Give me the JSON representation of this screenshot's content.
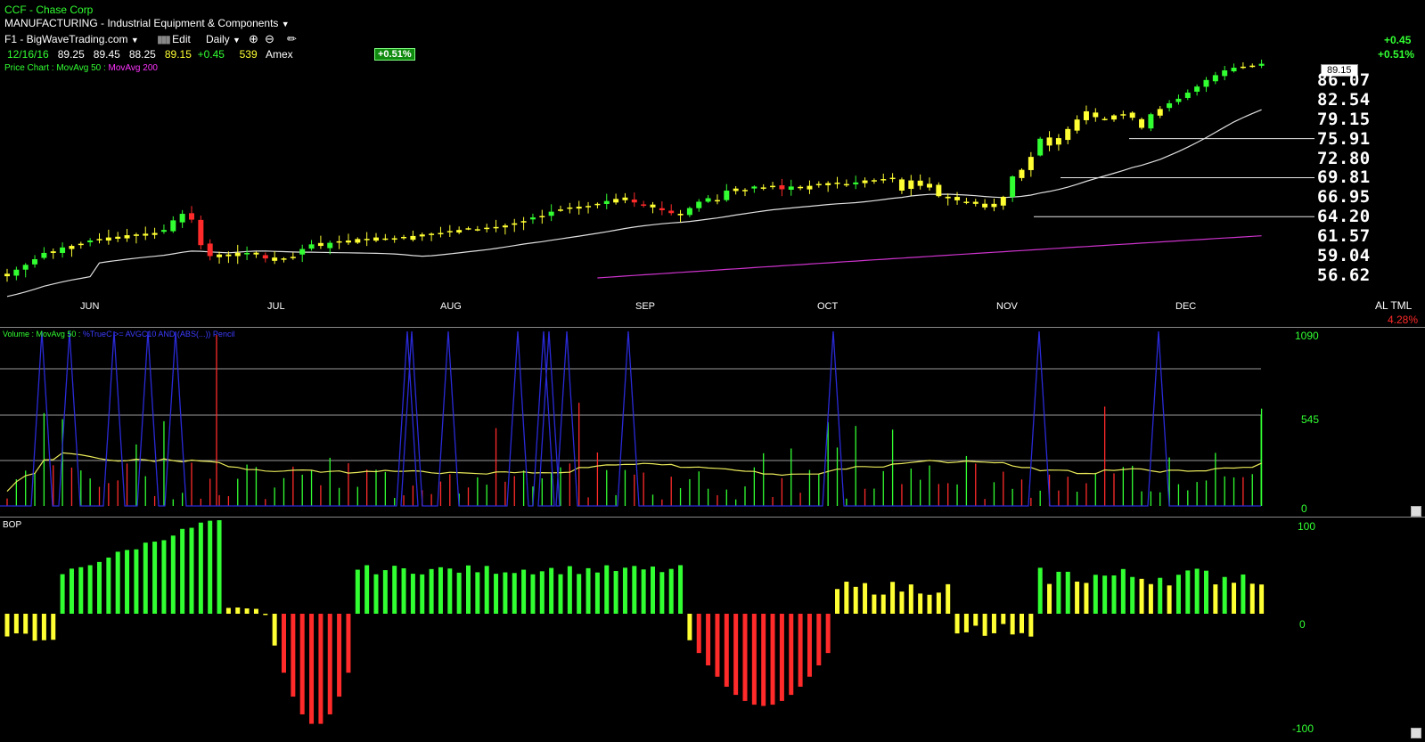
{
  "header": {
    "symbol_line": "CCF - Chase Corp",
    "industry": "MANUFACTURING - Industrial Equipment & Components",
    "layout_name": "F1 - BigWaveTrading.com",
    "edit_label": "Edit",
    "period_label": "Daily",
    "quote": {
      "date": "12/16/16",
      "open": "89.25",
      "high": "89.45",
      "low": "88.25",
      "close": "89.15",
      "change": "+0.45",
      "volume": "539",
      "exchange": "Amex"
    },
    "pct_badge": "+0.51%",
    "right_change": "+0.45",
    "right_pct": "+0.51%"
  },
  "price_panel": {
    "legend_prefix": "Price Chart : MovAvg 50 : ",
    "legend_ma200": "MovAvg 200",
    "last_price": "89.15",
    "price_labels": [
      "86.07",
      "82.54",
      "79.15",
      "75.91",
      "72.80",
      "69.81",
      "66.95",
      "64.20",
      "61.57",
      "59.04",
      "56.62"
    ],
    "months": [
      "JUN",
      "JUL",
      "AUG",
      "SEP",
      "OCT",
      "NOV",
      "DEC"
    ],
    "altml": "AL TML",
    "altml_pct": "4.28%"
  },
  "volume_panel": {
    "legend_prefix": "Volume : MovAvg 50 : ",
    "legend_pc": "%TrueC >= AVGC10 AND (ABS(...)) Pencil",
    "axis": [
      "1090",
      "545",
      "0"
    ]
  },
  "bop_panel": {
    "label": "BOP",
    "axis": [
      "100",
      "0",
      "-100"
    ]
  },
  "colors": {
    "background": "#000000",
    "up": "#32ff32",
    "neutral": "#ffff33",
    "down": "#ff2a2a",
    "ma50": "#e0e0e0",
    "ma200": "#cc33cc",
    "pc_line": "#2a2ad8"
  },
  "icons": [
    "bars-icon",
    "chevron-down-icon",
    "zoom-in-icon",
    "zoom-out-icon",
    "pencil-icon"
  ],
  "chart_data": {
    "type": "candlestick",
    "title": "CCF - Chase Corp",
    "period": "Daily",
    "ylim": [
      56.62,
      89.15
    ],
    "series": [
      {
        "name": "Price Chart",
        "values": [
          56.8,
          57.3,
          57.9,
          58.6,
          59.4,
          59.6,
          60.1,
          60.3,
          60.5,
          61.0,
          61.2,
          61.4,
          61.5,
          61.7,
          61.8,
          61.9,
          62.0,
          62.4,
          63.7,
          64.6,
          63.8,
          60.4,
          59.0,
          59.2,
          59.2,
          59.0,
          59.4,
          59.2,
          58.7,
          58.4,
          58.7,
          58.9,
          59.9,
          60.5,
          60.3,
          60.7,
          60.9,
          61.0,
          61.2,
          61.2,
          61.4,
          61.2,
          61.3,
          61.4,
          61.6,
          61.8,
          61.9,
          62.0,
          62.2,
          62.4,
          62.6,
          62.5,
          62.7,
          62.8,
          63.0,
          63.3,
          63.6,
          64.1,
          64.3,
          64.9,
          65.2,
          65.4,
          65.6,
          65.7,
          66.0,
          66.4,
          66.7,
          66.9,
          66.2,
          65.8,
          65.5,
          65.1,
          64.7,
          64.4,
          65.4,
          66.3,
          66.8,
          66.5,
          67.9,
          68.2,
          68.0,
          68.5,
          68.3,
          68.6,
          68.1,
          68.5,
          68.3,
          68.6,
          68.8,
          69.0,
          69.0,
          68.7,
          69.1,
          69.4,
          69.4,
          69.6,
          69.8,
          67.9,
          69.4,
          68.6,
          68.9,
          67.1,
          66.8,
          66.5,
          66.3,
          66.0,
          65.5,
          66.0,
          67.0,
          70.0,
          71.0,
          73.0,
          75.9,
          74.8,
          76.0,
          77.5,
          79.1,
          80.5,
          79.5,
          79.2,
          79.8,
          80.0,
          79.4,
          77.7,
          80.0,
          80.9,
          81.9,
          82.7,
          83.8,
          84.9,
          86.1,
          87.0,
          87.9,
          88.4,
          88.6,
          88.8,
          89.15
        ]
      },
      {
        "name": "MovAvg 50"
      },
      {
        "name": "MovAvg 200"
      },
      {
        "name": "Volume",
        "ylim": [
          0,
          1090
        ]
      },
      {
        "name": "BOP",
        "ylim": [
          -100,
          100
        ]
      }
    ],
    "x_labels": [
      "JUN",
      "JUL",
      "AUG",
      "SEP",
      "OCT",
      "NOV",
      "DEC"
    ]
  }
}
